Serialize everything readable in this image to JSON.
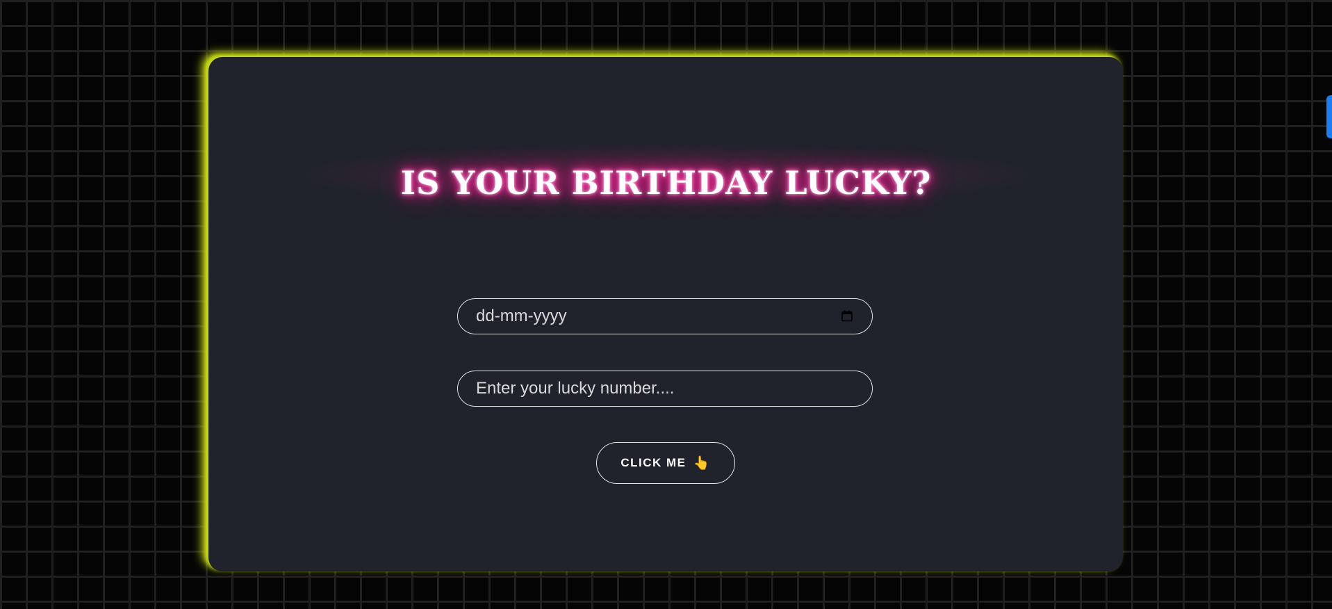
{
  "page": {
    "title": "IS YOUR BIRTHDAY LUCKY?"
  },
  "form": {
    "date_placeholder": "dd-mm-yyyy",
    "lucky_placeholder": "Enter your lucky number....",
    "button_label": "CLICK ME",
    "button_icon": "pointing-hand-icon"
  },
  "colors": {
    "card_background": "#21232c",
    "card_glow": "#c8dc10",
    "title_glow": "#ff1493",
    "page_background": "#050505",
    "side_tab": "#1a7ef2"
  }
}
